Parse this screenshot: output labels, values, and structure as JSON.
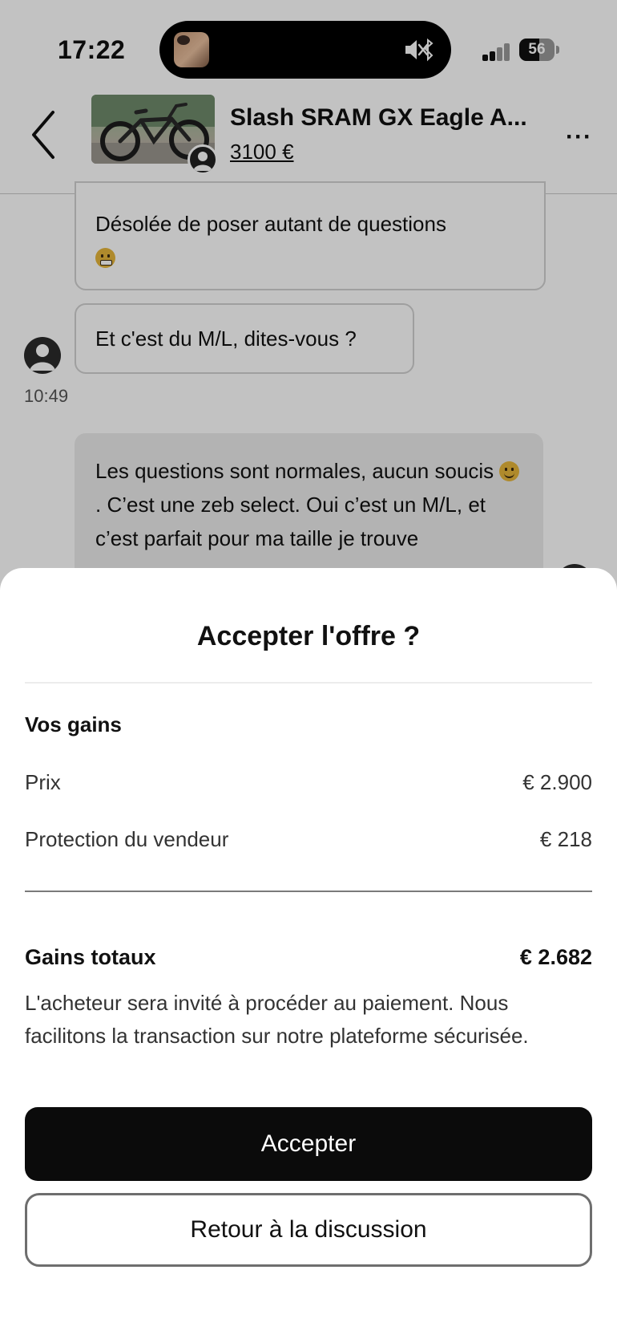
{
  "status_bar": {
    "time": "17:22",
    "battery": "56",
    "battery_fraction": 0.56
  },
  "header": {
    "product_title": "Slash SRAM GX Eagle A...",
    "product_price": "3100 €"
  },
  "messages": [
    {
      "text": "Désolée de poser autant de questions",
      "emoji": "grimacing-emoji"
    },
    {
      "text": "Et c'est du M/L, dites-vous ?",
      "time": "10:49"
    },
    {
      "text_before": "Les questions sont normales, aucun soucis ",
      "emoji": "slightly-smiling-emoji",
      "text_after": " . C’est une zeb select. Oui c’est un M/L, et c’est parfait pour ma taille je trouve"
    }
  ],
  "sheet": {
    "title": "Accepter l'offre ?",
    "section_title": "Vos gains",
    "rows": [
      {
        "label": "Prix",
        "value": "€ 2.900"
      },
      {
        "label": "Protection du vendeur",
        "value": "€ 218"
      }
    ],
    "total_label": "Gains totaux",
    "total_value": "€ 2.682",
    "note": "L'acheteur sera invité à procéder au paiement. Nous facilitons la transaction sur notre plateforme sécurisée.",
    "accept_button": "Accepter",
    "back_button": "Retour à la discussion"
  },
  "colors": {
    "primary_button": "#0b0b0b",
    "overlay": "rgba(0,0,0,0.24)"
  }
}
